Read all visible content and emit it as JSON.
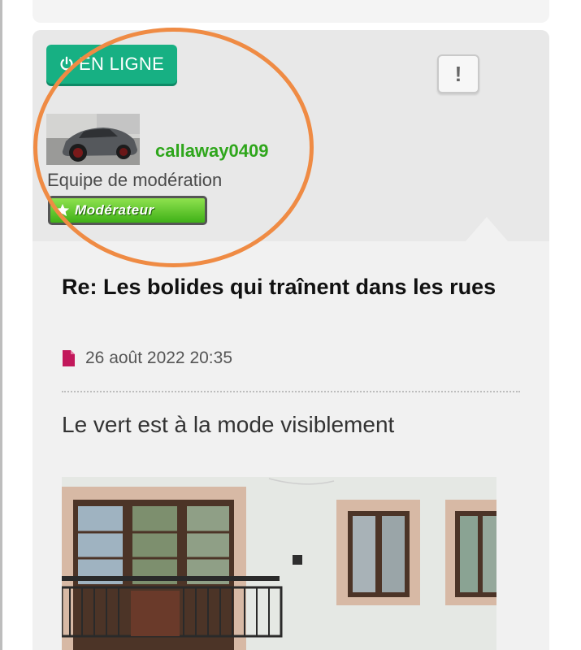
{
  "status": {
    "label": "EN LIGNE"
  },
  "report": {
    "label": "!"
  },
  "author": {
    "username": "callaway0409",
    "rank": "Equipe de modération",
    "badge": "Modérateur"
  },
  "post": {
    "title": "Re: Les bolides qui traînent dans les rues",
    "date": "26 août 2022 20:35",
    "body": "Le vert est à la mode visiblement"
  },
  "colors": {
    "online": "#17b083",
    "username": "#2fa61c",
    "highlight": "#ef8b44",
    "date_icon": "#c2185b"
  },
  "icons": {
    "status": "power-icon",
    "date": "document-icon",
    "badge": "star-icon"
  }
}
